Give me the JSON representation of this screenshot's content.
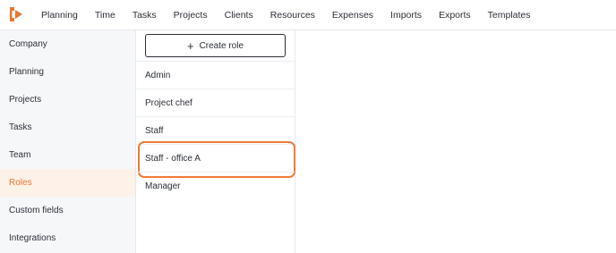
{
  "nav": {
    "items": [
      "Planning",
      "Time",
      "Tasks",
      "Projects",
      "Clients",
      "Resources",
      "Expenses",
      "Imports",
      "Exports",
      "Templates"
    ]
  },
  "sidebar": {
    "items": [
      {
        "label": "Company"
      },
      {
        "label": "Planning"
      },
      {
        "label": "Projects"
      },
      {
        "label": "Tasks"
      },
      {
        "label": "Team"
      },
      {
        "label": "Roles"
      },
      {
        "label": "Custom fields"
      },
      {
        "label": "Integrations"
      }
    ],
    "active": "Roles"
  },
  "roles": {
    "create_label": "Create role",
    "items": [
      {
        "label": "Admin"
      },
      {
        "label": "Project chef"
      },
      {
        "label": "Staff"
      },
      {
        "label": "Staff - office A"
      },
      {
        "label": "Manager"
      }
    ],
    "highlighted": "Staff - office A"
  },
  "colors": {
    "accent": "#e8772e",
    "highlight_border": "#f07a3a",
    "sidebar_bg": "#f6f7f9",
    "active_bg": "#fdf1e8"
  }
}
